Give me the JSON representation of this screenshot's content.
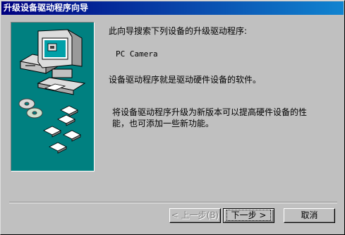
{
  "window": {
    "title": "升级设备驱动程序向导"
  },
  "content": {
    "intro": "此向导搜索下列设备的升级驱动程序:",
    "device_name": "PC Camera",
    "definition": "设备驱动程序就是驱动硬件设备的软件。",
    "benefit_line1": "将设备驱动程序升级为新版本可以提高硬件设备的性",
    "benefit_line2": "能，也可添加一些新功能。"
  },
  "buttons": {
    "back_label": "< 上一步(B)",
    "next_label": "下一步 >",
    "cancel_label": "取消"
  },
  "colors": {
    "title_bar": "#000080",
    "illustration_bg": "#008080",
    "face": "#c0c0c0"
  },
  "icons": [
    "computer-icon",
    "cd-disc-icon",
    "floppy-disk-icon"
  ]
}
